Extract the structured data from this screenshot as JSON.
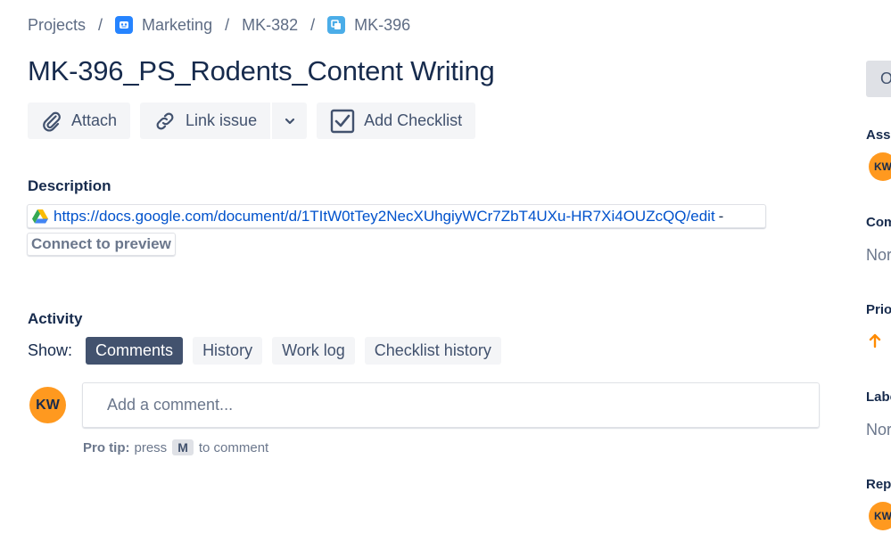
{
  "breadcrumb": {
    "projects": "Projects",
    "separator": "/",
    "project": "Marketing",
    "parent": "MK-382",
    "issue": "MK-396"
  },
  "issue": {
    "title": "MK-396_PS_Rodents_Content Writing"
  },
  "toolbar": {
    "attach_label": "Attach",
    "link_issue_label": "Link issue",
    "add_checklist_label": "Add Checklist"
  },
  "description": {
    "label": "Description",
    "link_url": "https://docs.google.com/document/d/1TItW0tTey2NecXUhgiyWCr7ZbT4UXu-HR7Xi4OUZcQQ/edit",
    "link_suffix": "-",
    "preview_label": "Connect to preview"
  },
  "activity": {
    "label": "Activity",
    "show_label": "Show:",
    "tabs": [
      "Comments",
      "History",
      "Work log",
      "Checklist history"
    ],
    "active_tab": "Comments",
    "comment_placeholder": "Add a comment...",
    "avatar_initials": "KW",
    "protip_bold": "Pro tip:",
    "protip_pre": "press",
    "protip_key": "M",
    "protip_post": "to comment"
  },
  "sidebar": {
    "status_initial": "O",
    "assignee_label": "Assi",
    "assignee_initials": "KW",
    "component_label": "Com",
    "component_value": "Nor",
    "priority_label": "Prio",
    "labels_label": "Labe",
    "labels_value": "Nor",
    "reporter_label": "Repo",
    "reporter_initials": "KW"
  },
  "colors": {
    "accent": "#0052cc",
    "avatar": "#ff991f",
    "priority": "#ff8b00",
    "active_chip": "#42526e"
  }
}
